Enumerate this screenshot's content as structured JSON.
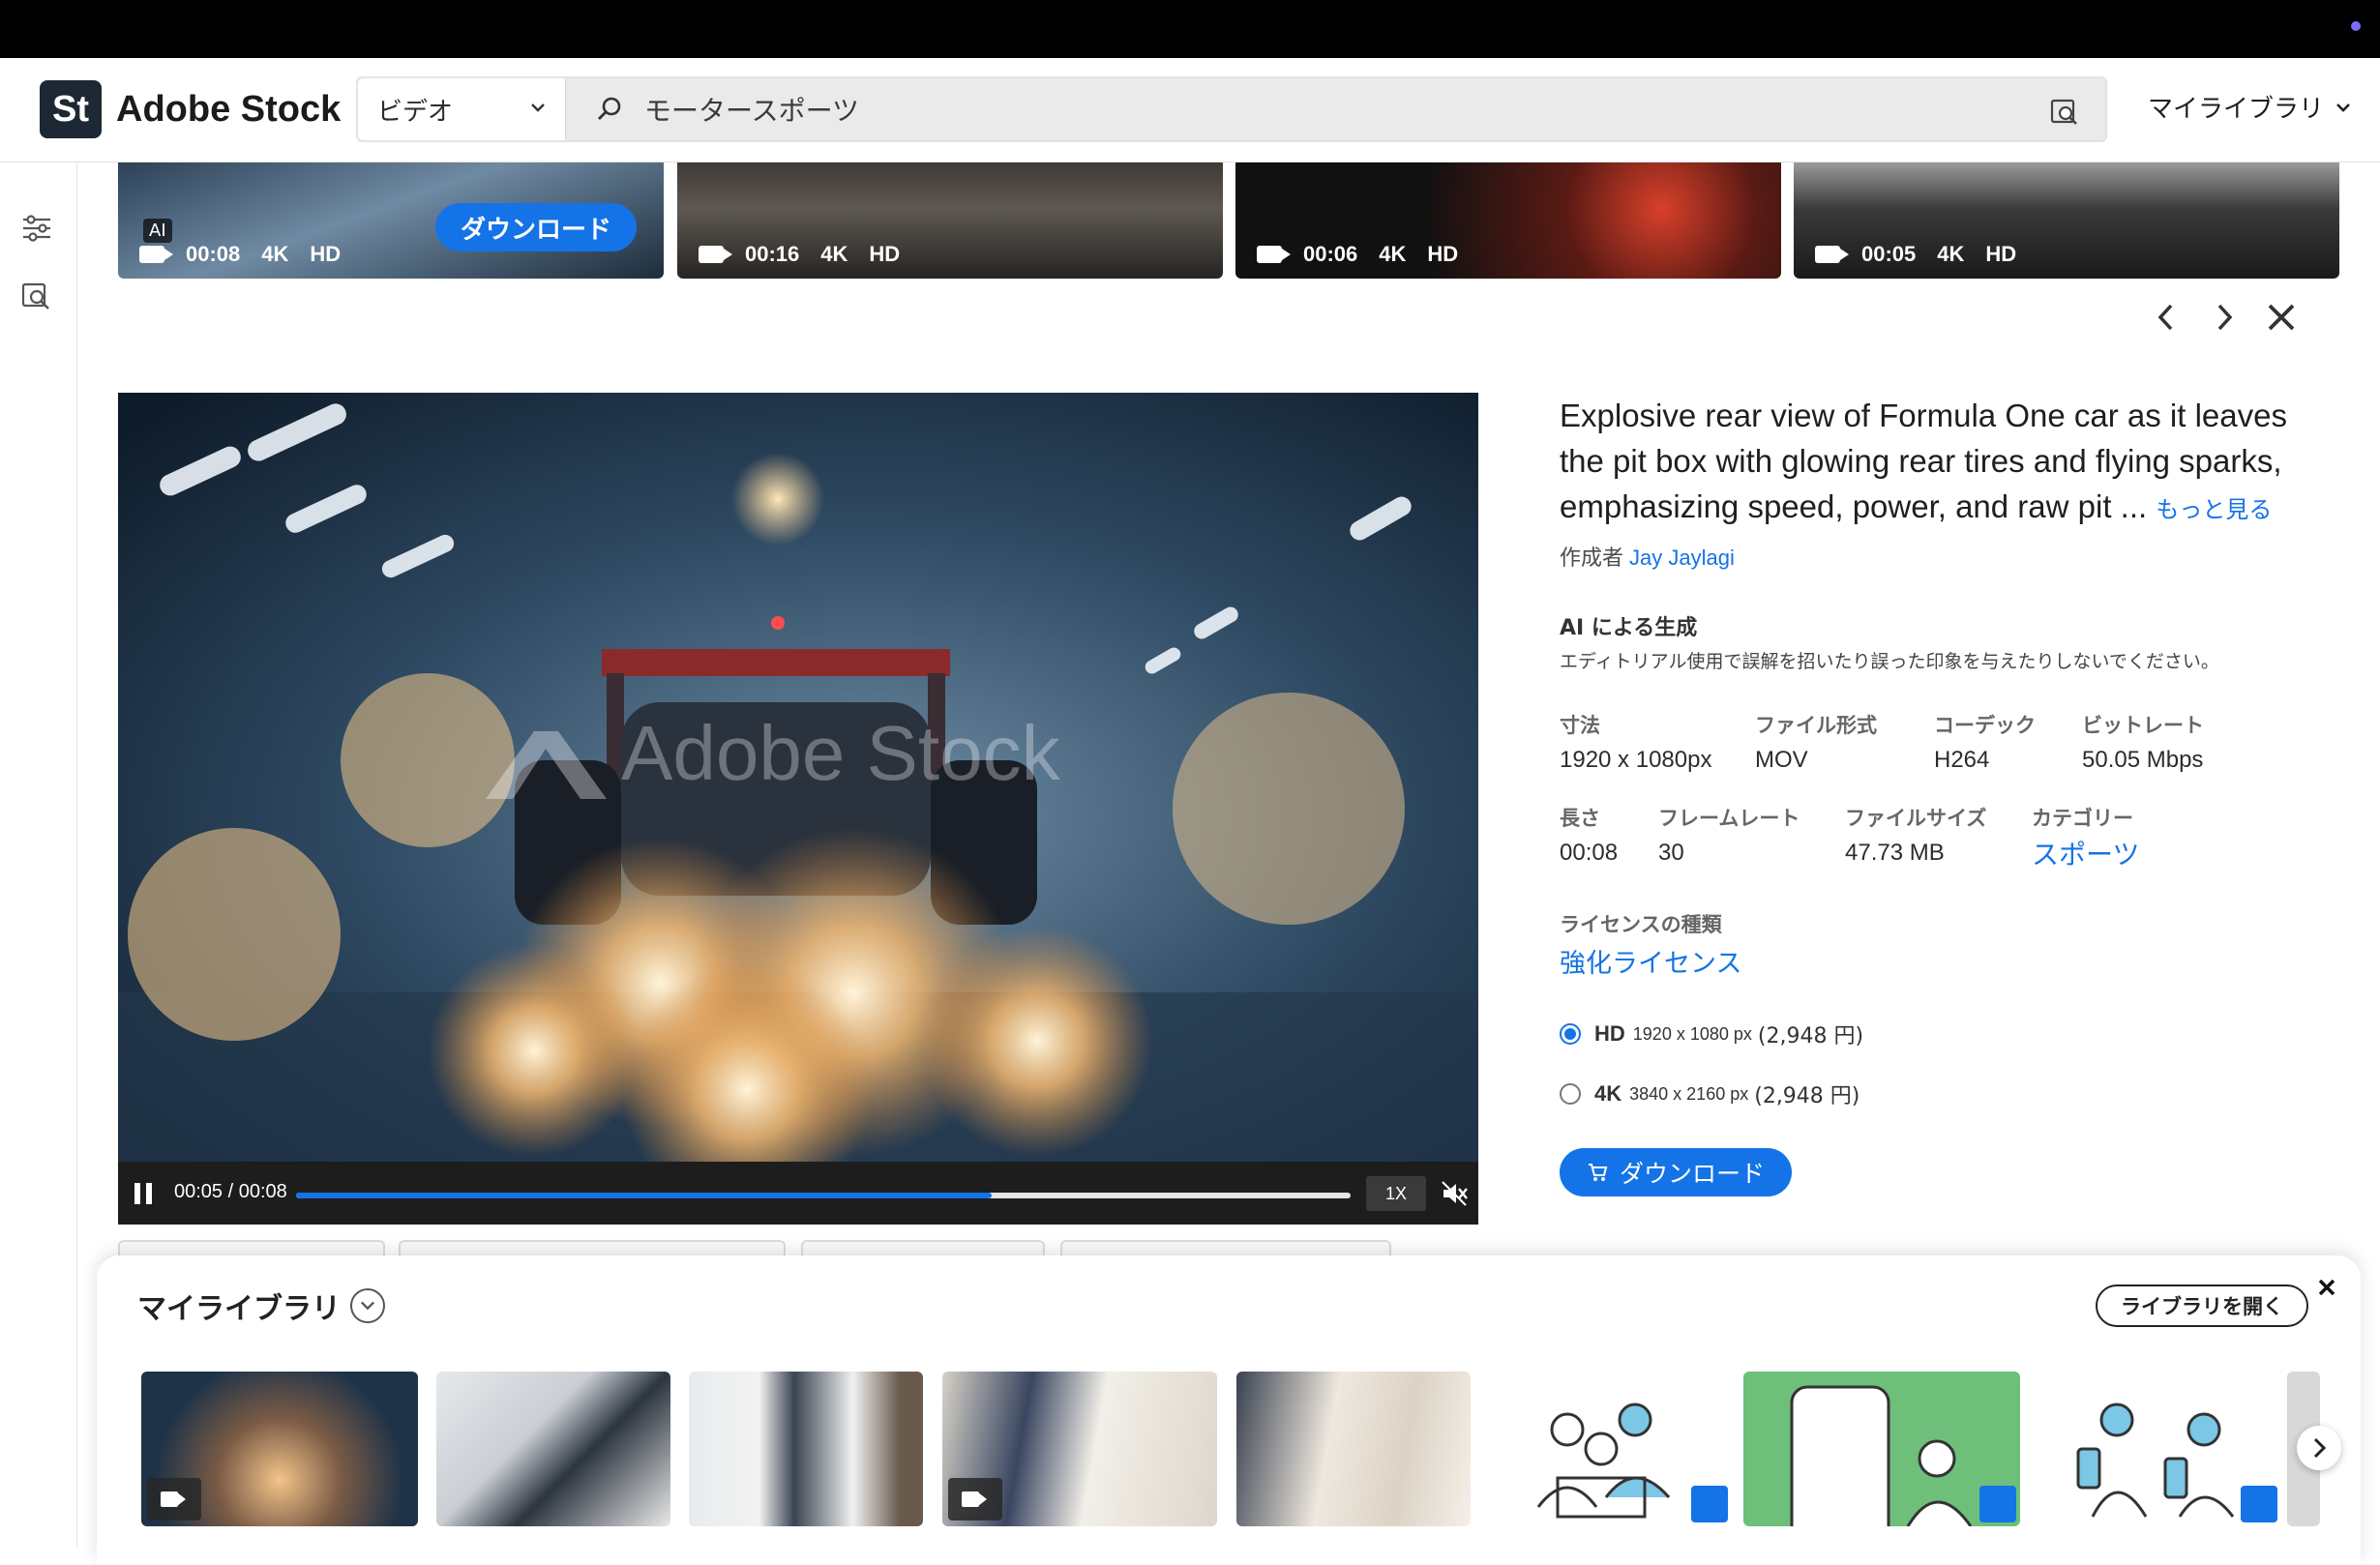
{
  "app": {
    "logo_mark": "St",
    "logo_text": "Adobe Stock"
  },
  "search": {
    "type": "ビデオ",
    "query": "モータースポーツ"
  },
  "header": {
    "library_menu": "マイライブラリ"
  },
  "strip": [
    {
      "ai_badge": "AI",
      "duration": "00:08",
      "k4": "4K",
      "hd": "HD",
      "download": "ダウンロード"
    },
    {
      "duration": "00:16",
      "k4": "4K",
      "hd": "HD"
    },
    {
      "duration": "00:06",
      "k4": "4K",
      "hd": "HD"
    },
    {
      "duration": "00:05",
      "k4": "4K",
      "hd": "HD"
    }
  ],
  "player": {
    "time": "00:05 / 00:08",
    "progress": 0.66,
    "speed": "1X"
  },
  "details": {
    "title": "Explosive rear view of Formula One car as it leaves the pit box with glowing rear tires and flying sparks, emphasizing speed, power, and raw pit ...",
    "more": "もっと見る",
    "author_label": "作成者",
    "author": "Jay Jaylagi",
    "ai_title": "AI による生成",
    "ai_desc": "エディトリアル使用で誤解を招いたり誤った印象を与えたりしないでください。",
    "specs1": [
      {
        "k": "寸法",
        "v": "1920 x 1080px"
      },
      {
        "k": "ファイル形式",
        "v": "MOV"
      },
      {
        "k": "コーデック",
        "v": "H264"
      },
      {
        "k": "ビットレート",
        "v": "50.05 Mbps"
      }
    ],
    "specs2": [
      {
        "k": "長さ",
        "v": "00:08"
      },
      {
        "k": "フレームレート",
        "v": "30"
      },
      {
        "k": "ファイルサイズ",
        "v": "47.73 MB"
      },
      {
        "k": "カテゴリー",
        "v": "スポーツ"
      }
    ],
    "license_label": "ライセンスの種類",
    "license_value": "強化ライセンス",
    "options": [
      {
        "res": "HD",
        "px": "1920 x 1080 px",
        "price": "(2,948 円)",
        "selected": true
      },
      {
        "res": "4K",
        "px": "3840 x 2160 px",
        "price": "(2,948 円)",
        "selected": false
      }
    ],
    "download": "ダウンロード"
  },
  "library": {
    "title": "マイライブラリ",
    "open": "ライブラリを開く"
  },
  "colors": {
    "accent": "#1473e6",
    "brand_dark": "#1c2833"
  }
}
